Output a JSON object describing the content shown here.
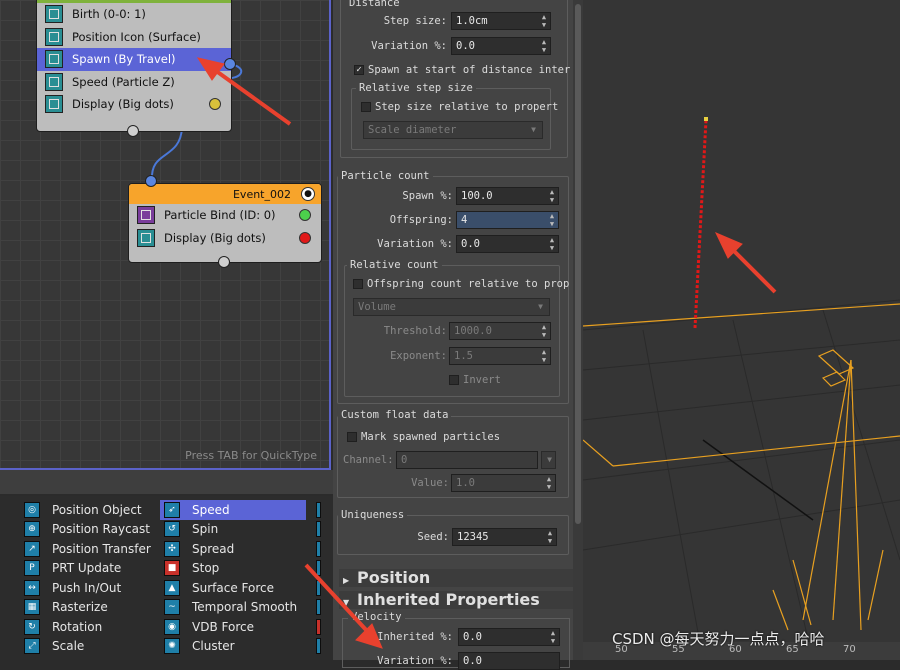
{
  "graph": {
    "hint": "Press TAB for QuickType",
    "node1": {
      "rows": [
        {
          "label": "Birth (0-0: 1)",
          "icon": "birth-icon"
        },
        {
          "label": "Position Icon (Surface)",
          "icon": "position-icon"
        },
        {
          "label": "Spawn (By Travel)",
          "icon": "spawn-icon"
        },
        {
          "label": "Speed (Particle Z)",
          "icon": "speed-icon"
        },
        {
          "label": "Display (Big dots)",
          "icon": "display-icon"
        }
      ]
    },
    "node2": {
      "title": "Event_002",
      "rows": [
        {
          "label": "Particle Bind (ID: 0)",
          "icon": "particle-bind-icon"
        },
        {
          "label": "Display (Big dots)",
          "icon": "display-icon"
        }
      ]
    }
  },
  "operators": {
    "col1": [
      "Position Object",
      "Position Raycast",
      "Position Transfer",
      "PRT Update",
      "Push In/Out",
      "Rasterize",
      "Rotation",
      "Scale"
    ],
    "col2": [
      "Speed",
      "Spin",
      "Spread",
      "Stop",
      "Surface Force",
      "Temporal Smooth",
      "VDB Force",
      "Cluster"
    ]
  },
  "panel": {
    "distance": {
      "title": "Distance",
      "step_size_label": "Step size:",
      "step_size_value": "1.0cm",
      "variation_label": "Variation %:",
      "variation_value": "0.0",
      "spawn_at_start": "Spawn at start of distance inter",
      "relative_step_title": "Relative step size",
      "step_relative": "Step size relative to propert",
      "scale_dropdown": "Scale diameter"
    },
    "particle_count": {
      "title": "Particle count",
      "spawn_label": "Spawn %:",
      "spawn_value": "100.0",
      "offspring_label": "Offspring:",
      "offspring_value": "4",
      "variation_label": "Variation %:",
      "variation_value": "0.0",
      "relative_title": "Relative count",
      "offspring_relative": "Offspring count relative to prop",
      "volume_dropdown": "Volume",
      "threshold_label": "Threshold:",
      "threshold_value": "1000.0",
      "exponent_label": "Exponent:",
      "exponent_value": "1.5",
      "invert": "Invert"
    },
    "custom_float": {
      "title": "Custom float data",
      "mark": "Mark spawned particles",
      "channel_label": "Channel:",
      "channel_value": "0",
      "value_label": "Value:",
      "value_value": "1.0"
    },
    "uniqueness": {
      "title": "Uniqueness",
      "seed_label": "Seed:",
      "seed_value": "12345"
    },
    "rollouts": {
      "position": "Position",
      "inherited": "Inherited Properties",
      "velocity": "Velocity",
      "inherited_pct_label": "Inherited %:",
      "inherited_pct_value": "0.0",
      "variation_label": "Variation %:",
      "variation_value": "0.0"
    }
  },
  "viewport": {
    "ruler": [
      "50",
      "55",
      "60",
      "65",
      "70"
    ],
    "watermark": "CSDN @每天努力一点点，哈哈"
  }
}
